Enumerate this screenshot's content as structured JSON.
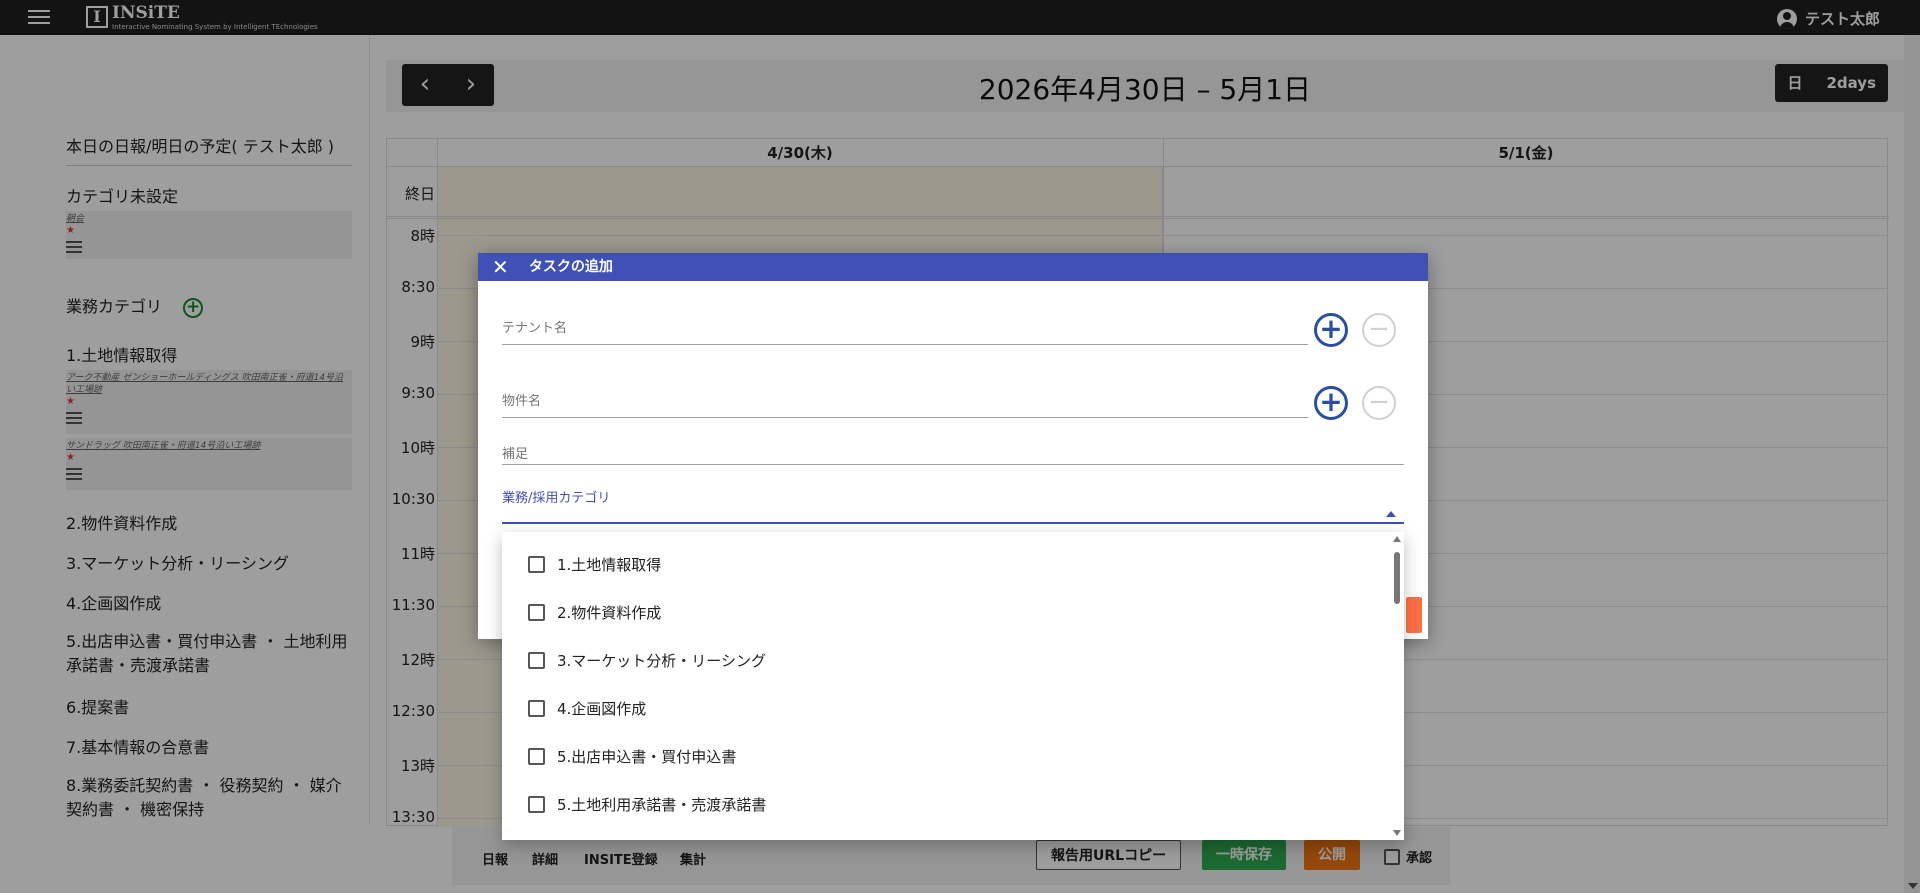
{
  "app": {
    "logo_mark": "I",
    "logo_name": "INSiTE",
    "logo_tagline": "Interactive Nominating System by Intelligent TEchnologies",
    "user_name": "テスト太郎"
  },
  "sidebar": {
    "heading": "本日の日報/明日の予定( テスト太郎 )",
    "uncategorized": {
      "label": "カテゴリ未設定",
      "item_text": "朝会"
    },
    "business_category_label": "業務カテゴリ",
    "categories": [
      {
        "label": "1.土地情報取得"
      },
      {
        "label": "2.物件資料作成"
      },
      {
        "label": "3.マーケット分析・リーシング"
      },
      {
        "label": "4.企画図作成"
      },
      {
        "label": "5.出店申込書・買付申込書 ・ 土地利用承諾書・売渡承諾書"
      },
      {
        "label": "6.提案書"
      },
      {
        "label": "7.基本情報の合意書"
      },
      {
        "label": "8.業務委託契約書 ・ 役務契約 ・ 媒介契約書 ・ 機密保持"
      }
    ],
    "cat1_items": [
      {
        "tags": [
          "アーク不動産",
          "ゼンショーホールディングス",
          "吹田南正雀・府道14号沿い工場跡"
        ]
      },
      {
        "tags": [
          "サンドラッグ",
          "吹田南正雀・府道14号沿い工場跡"
        ]
      }
    ],
    "star": "★"
  },
  "calendar": {
    "prev": "‹",
    "next": "›",
    "title": "2026年4月30日 – 5月1日",
    "views": [
      "日",
      "2days"
    ],
    "days": [
      "4/30(木)",
      "5/1(金)"
    ],
    "allday_label": "終日",
    "times": [
      "8時",
      "8:30",
      "9時",
      "9:30",
      "10時",
      "10:30",
      "11時",
      "11:30",
      "12時",
      "12:30",
      "13時",
      "13:30"
    ]
  },
  "bottom": {
    "links": [
      "日報",
      "詳細",
      "INSITE登録",
      "集計"
    ],
    "copy_url": "報告用URLコピー",
    "temp_save": "一時保存",
    "publish": "公開",
    "approve": "承認",
    "colors": {
      "save": "#2eaa50",
      "publish": "#f0740f"
    }
  },
  "dialog": {
    "title": "タスクの追加",
    "close_icon": "close-icon",
    "tenant_placeholder": "テナント名",
    "property_placeholder": "物件名",
    "note_placeholder": "補足",
    "category_label": "業務/採用カテゴリ",
    "header_color": "#3f51b5",
    "options": [
      "1.土地情報取得",
      "2.物件資料作成",
      "3.マーケット分析・リーシング",
      "4.企画図作成",
      "5.出店申込書・買付申込書",
      "5.土地利用承諾書・売渡承諾書"
    ]
  }
}
